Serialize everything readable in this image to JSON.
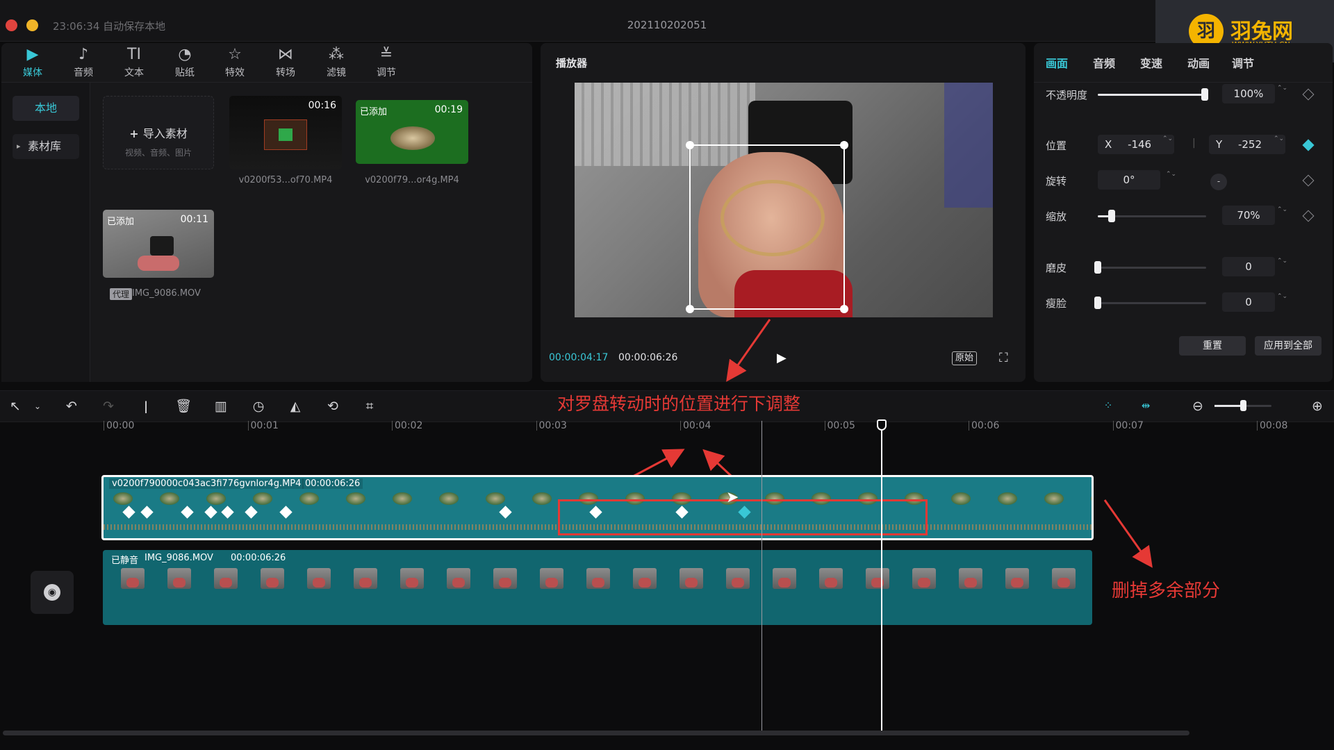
{
  "titlebar": {
    "autosave": "23:06:34 自动保存本地",
    "project": "202110202051",
    "colors": {
      "close": "#e0443e",
      "minimize": "#f0b428"
    }
  },
  "logo": {
    "mark": "羽",
    "name": "羽兔网",
    "url": "WWW.YUTU.CN"
  },
  "media_toolbar": [
    {
      "label": "媒体",
      "icon": "media-icon",
      "glyph": "▶"
    },
    {
      "label": "音频",
      "icon": "audio-icon",
      "glyph": "♪"
    },
    {
      "label": "文本",
      "icon": "text-icon",
      "glyph": "TI"
    },
    {
      "label": "贴纸",
      "icon": "sticker-icon",
      "glyph": "◔"
    },
    {
      "label": "特效",
      "icon": "effects-icon",
      "glyph": "☆"
    },
    {
      "label": "转场",
      "icon": "transition-icon",
      "glyph": "⋈"
    },
    {
      "label": "滤镜",
      "icon": "filter-icon",
      "glyph": "⁂"
    },
    {
      "label": "调节",
      "icon": "adjust-icon",
      "glyph": "≚"
    }
  ],
  "media_sidebar": {
    "local": "本地",
    "library": "素材库",
    "library_arrow": "▸"
  },
  "import": {
    "title": "导入素材",
    "plus": "+",
    "subtitle": "视频、音频、图片"
  },
  "media_clips": [
    {
      "duration": "00:16",
      "filename": "v0200f53...of70.MP4",
      "tag": ""
    },
    {
      "duration": "00:19",
      "filename": "v0200f79...or4g.MP4",
      "tag": "已添加"
    },
    {
      "duration": "00:11",
      "filename": "IMG_9086.MOV",
      "tag": "已添加",
      "proxy": "代理"
    }
  ],
  "player": {
    "title": "播放器",
    "current_time": "00:00:04:17",
    "total_time": "00:00:06:26",
    "original_label": "原始",
    "play_glyph": "▶",
    "fullscreen_glyph": "⛶"
  },
  "properties": {
    "tabs": [
      "画面",
      "音频",
      "变速",
      "动画",
      "调节"
    ],
    "opacity": {
      "label": "不透明度",
      "value": "100%",
      "fraction": 1.0
    },
    "position": {
      "label": "位置",
      "x_label": "X",
      "x": "-146",
      "y_label": "Y",
      "y": "-252",
      "separator": "|"
    },
    "rotation": {
      "label": "旋转",
      "value": "0°",
      "dial": "-"
    },
    "scale": {
      "label": "缩放",
      "value": "70%",
      "fraction": 0.12
    },
    "smooth": {
      "label": "磨皮",
      "value": "0",
      "fraction": 0.0
    },
    "slim": {
      "label": "瘦脸",
      "value": "0",
      "fraction": 0.0
    },
    "reset": "重置",
    "apply_all": "应用到全部",
    "stepper": "⌃⌄",
    "accent": "#39c7d6"
  },
  "timeline_toolbar": {
    "tools": [
      {
        "icon": "select-icon",
        "glyph": "↖"
      },
      {
        "icon": "undo-icon",
        "glyph": "↶"
      },
      {
        "icon": "redo-icon",
        "glyph": "↷"
      },
      {
        "icon": "split-icon",
        "glyph": "ǀ"
      },
      {
        "icon": "delete-icon",
        "glyph": "🗑"
      },
      {
        "icon": "freeze-icon",
        "glyph": "▥"
      },
      {
        "icon": "reverse-icon",
        "glyph": "◷"
      },
      {
        "icon": "mirror-icon",
        "glyph": "◭"
      },
      {
        "icon": "rotate-icon",
        "glyph": "⟲"
      },
      {
        "icon": "crop-icon",
        "glyph": "⌗"
      }
    ],
    "zoom_out": "⊖",
    "zoom_in": "⊕"
  },
  "annotations": {
    "top": "对罗盘转动时的位置进行下调整",
    "right": "删掉多余部分"
  },
  "ruler": [
    "00:00",
    "00:01",
    "00:02",
    "00:03",
    "00:04",
    "00:05",
    "00:06",
    "00:07",
    "00:08"
  ],
  "tracks": {
    "main": {
      "name": "v0200f790000c043ac3fi776gvnlor4g.MP4",
      "duration": "00:00:06:26"
    },
    "second": {
      "status": "已静音",
      "name": "IMG_9086.MOV",
      "duration": "00:00:06:26"
    }
  }
}
